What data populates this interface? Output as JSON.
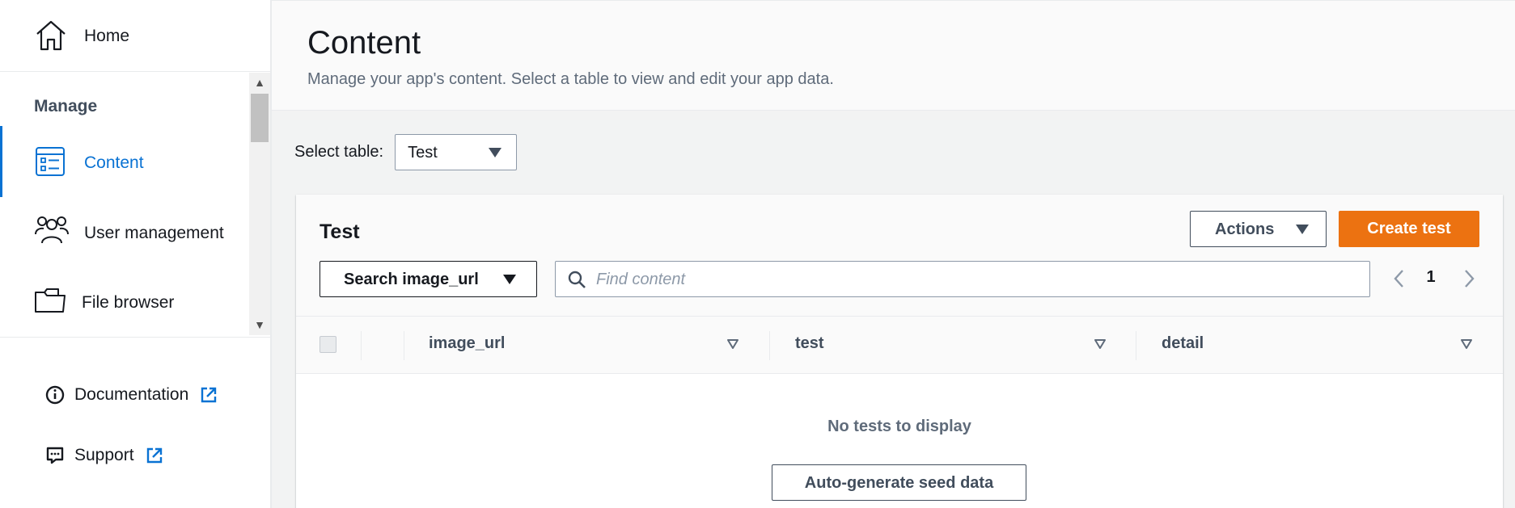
{
  "sidebar": {
    "home_label": "Home",
    "section_title": "Manage",
    "items": [
      {
        "label": "Content",
        "icon": "content-list-icon",
        "active": true
      },
      {
        "label": "User management",
        "icon": "users-icon",
        "active": false
      },
      {
        "label": "File browser",
        "icon": "folder-icon",
        "active": false
      }
    ],
    "links": [
      {
        "label": "Documentation",
        "icon": "info-icon"
      },
      {
        "label": "Support",
        "icon": "chat-icon"
      }
    ]
  },
  "header": {
    "title": "Content",
    "description": "Manage your app's content. Select a table to view and edit your app data."
  },
  "table_select": {
    "label": "Select table:",
    "value": "Test"
  },
  "table": {
    "title": "Test",
    "actions_label": "Actions",
    "create_label": "Create test",
    "search_field_label": "Search image_url",
    "find_placeholder": "Find content",
    "current_page": "1",
    "columns": [
      "image_url",
      "test",
      "detail"
    ],
    "empty_message": "No tests to display",
    "seed_button_label": "Auto-generate seed data"
  },
  "colors": {
    "accent": "#0972d3",
    "primary_button": "#ec7211",
    "text": "#16191f",
    "muted": "#5f6b7a"
  }
}
